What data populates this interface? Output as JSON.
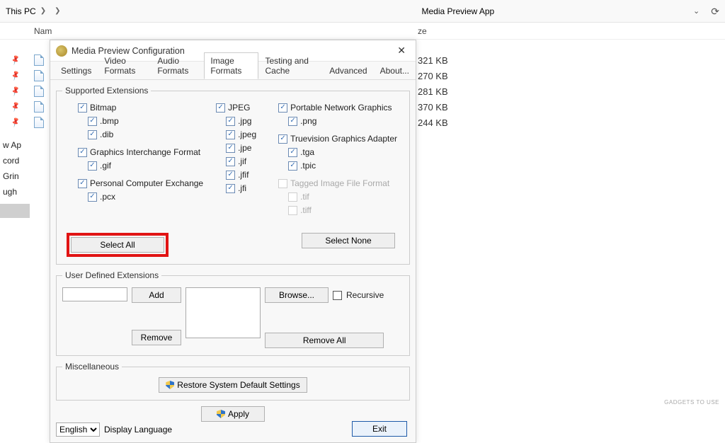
{
  "explorer": {
    "breadcrumb": [
      "This PC",
      "",
      "Media Preview App"
    ],
    "col_name": "Nam",
    "col_size_header": "ze",
    "sizes": [
      "321 KB",
      "270 KB",
      "281 KB",
      "370 KB",
      "244 KB"
    ],
    "sidebar_labels": [
      "w Ap",
      "cord",
      "Grin",
      "ugh"
    ]
  },
  "dialog": {
    "title": "Media Preview Configuration",
    "tabs": [
      "Settings",
      "Video Formats",
      "Audio Formats",
      "Image Formats",
      "Testing and Cache",
      "Advanced",
      "About..."
    ],
    "active_tab": "Image Formats",
    "supported_legend": "Supported Extensions",
    "groups": {
      "bitmap": {
        "label": "Bitmap",
        "subs": [
          ".bmp",
          ".dib"
        ]
      },
      "gif": {
        "label": "Graphics Interchange Format",
        "subs": [
          ".gif"
        ]
      },
      "pcx": {
        "label": "Personal Computer Exchange",
        "subs": [
          ".pcx"
        ]
      },
      "jpeg": {
        "label": "JPEG",
        "subs": [
          ".jpg",
          ".jpeg",
          ".jpe",
          ".jif",
          ".jfif",
          ".jfi"
        ]
      },
      "png": {
        "label": "Portable Network Graphics",
        "subs": [
          ".png"
        ]
      },
      "tga": {
        "label": "Truevision Graphics Adapter",
        "subs": [
          ".tga",
          ".tpic"
        ]
      },
      "tiff": {
        "label": "Tagged Image File Format",
        "subs": [
          ".tif",
          ".tiff"
        ]
      }
    },
    "select_all": "Select All",
    "select_none": "Select None",
    "ude_legend": "User Defined Extensions",
    "add": "Add",
    "remove": "Remove",
    "browse": "Browse...",
    "recursive": "Recursive",
    "remove_all": "Remove All",
    "misc_legend": "Miscellaneous",
    "restore": "Restore System Default Settings",
    "apply": "Apply",
    "language_value": "English",
    "display_language": "Display Language",
    "exit": "Exit"
  }
}
